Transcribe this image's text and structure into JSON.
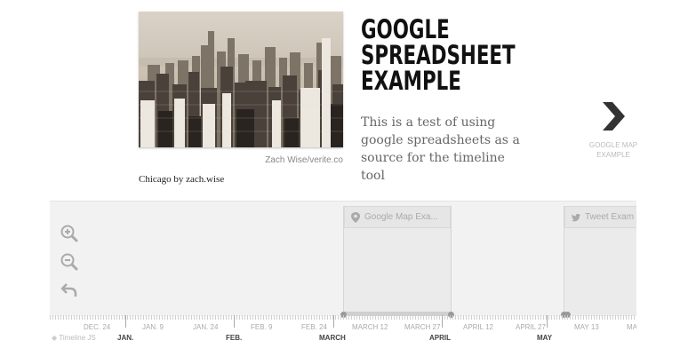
{
  "slide": {
    "media_credit": "Zach Wise/verite.co",
    "media_caption": "Chicago by zach.wise",
    "headline_lines": [
      "GOOGLE",
      "SPREADSHEET",
      "EXAMPLE"
    ],
    "text": "This is a test of using google spreadsheets as a source for the timeline tool"
  },
  "nav_next": {
    "icon": "chevron-right-icon",
    "label_lines": [
      "GOOGLE MAP",
      "EXAMPLE"
    ]
  },
  "timenav": {
    "zoom_in_icon": "zoom-in-icon",
    "zoom_out_icon": "zoom-out-icon",
    "back_icon": "back-arrow-icon",
    "markers": [
      {
        "title": "Google Map Exa...",
        "icon": "map-pin-icon"
      },
      {
        "title": "Tweet Exam",
        "icon": "twitter-icon"
      }
    ],
    "minor_labels": [
      "DEC. 24",
      "JAN. 9",
      "JAN. 24",
      "FEB. 9",
      "FEB. 24",
      "MARCH 12",
      "MARCH 27",
      "APRIL 12",
      "APRIL 27",
      "MAY 13",
      "MA"
    ],
    "major_labels": [
      "JAN.",
      "FEB.",
      "MARCH",
      "APRIL",
      "MAY"
    ],
    "brand": "Timeline JS"
  },
  "colors": {
    "timenav_bg": "#f2f2f2",
    "accent_dark": "#333333"
  }
}
